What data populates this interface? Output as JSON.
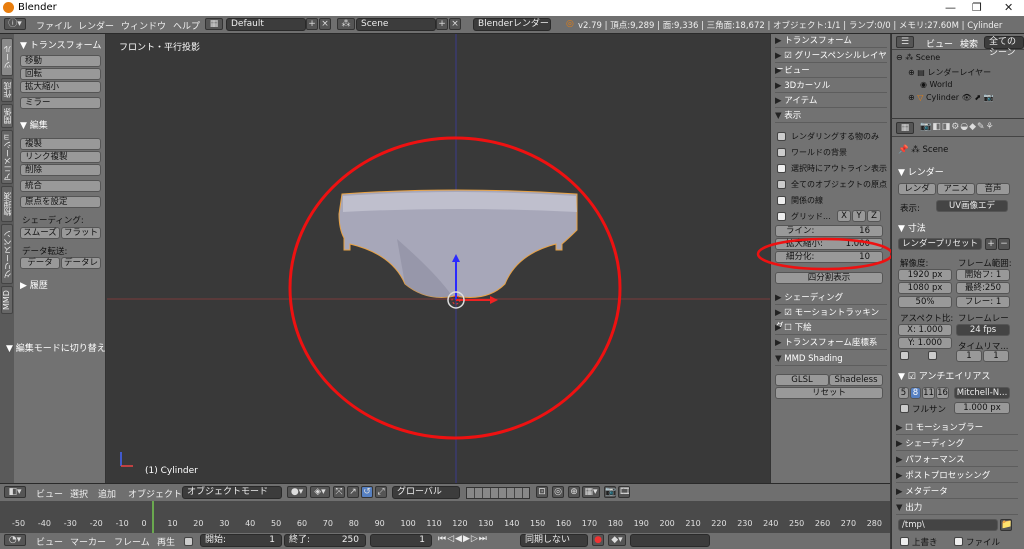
{
  "window": {
    "title": "Blender"
  },
  "info": {
    "menus": [
      "ファイル",
      "レンダー",
      "ウィンドウ",
      "ヘルプ"
    ],
    "layout": "Default",
    "scene": "Scene",
    "engine": "Blenderレンダー",
    "stats": "v2.79 | 頂点:9,289 | 面:9,336 | 三角面:18,672 | オブジェクト:1/1 | ランプ:0/0 | メモリ:27.60M | Cylinder"
  },
  "tabs": [
    "ツール",
    "作成",
    "関係",
    "アニメーション",
    "物理演算",
    "グリースペンシル",
    "MMD"
  ],
  "toolshelf": {
    "transform_header": "トランスフォーム",
    "transform": [
      "移動",
      "回転",
      "拡大縮小"
    ],
    "mirror": "ミラー",
    "edit_header": "編集",
    "edit": [
      "複製",
      "リンク複製",
      "削除"
    ],
    "join": "統合",
    "origin": "原点を設定",
    "shading_label": "シェーディング:",
    "smooth": "スムーズ",
    "flat": "フラット",
    "data_label": "データ転送:",
    "data": "データ",
    "data_l": "データレ",
    "history": "履歴",
    "op_panel": "編集モードに切り替え"
  },
  "viewport": {
    "view_name": "フロント・平行投影",
    "object_name": "(1) Cylinder"
  },
  "npanel": {
    "headers": [
      "トランスフォーム",
      "グリースペンシルレイヤー",
      "ビュー",
      "3Dカーソル",
      "アイテム",
      "表示"
    ],
    "checks": [
      "レンダリングする物のみ",
      "ワールドの背景",
      "選択時にアウトライン表示",
      "全てのオブジェクトの原点",
      "関係の線"
    ],
    "grid": "グリッド...",
    "axes": [
      "X",
      "Y",
      "Z"
    ],
    "lines_label": "ライン:",
    "lines_val": "16",
    "scale_label": "拡大縮小:",
    "scale_val": "1.000",
    "sub_label": "細分化:",
    "sub_val": "10",
    "quad": "四分割表示",
    "bottom_headers": [
      "シェーディング",
      "モーショントラッキング",
      "下絵",
      "トランスフォーム座標系"
    ],
    "mmd": "MMD Shading",
    "glsl": "GLSL",
    "shadeless": "Shadeless",
    "reset": "リセット"
  },
  "outliner": {
    "view": "ビュー",
    "search": "検索",
    "filter": "全てのシーン",
    "items": [
      "Scene",
      "レンダーレイヤー",
      "World",
      "Cylinder"
    ]
  },
  "props": {
    "scene": "Scene",
    "render": "レンダー",
    "render_btn": "レンダ",
    "anim_btn": "アニメ",
    "audio_btn": "音声",
    "display_label": "表示:",
    "display_val": "UV画像エデ",
    "dims": "寸法",
    "preset": "レンダープリセット",
    "res_label": "解像度:",
    "frame_label": "フレーム範囲:",
    "rx": "1920 px",
    "ry": "1080 px",
    "pct": "50%",
    "start": "開始フ: 1",
    "end": "最終:250",
    "step": "フレー: 1",
    "aspect_label": "アスペクト比:",
    "fr_label": "フレームレー",
    "ax": "X: 1.000",
    "ay": "Y: 1.000",
    "fps": "24 fps",
    "remap": "タイムリマ...",
    "r1": "1",
    "r2": "1",
    "aa": "アンチエイリアス",
    "aa_vals": [
      "5",
      "8",
      "11",
      "16"
    ],
    "filter": "Mitchell-N...",
    "full": "フルサン",
    "px": "1.000 px",
    "sections": [
      "モーションブラー",
      "シェーディング",
      "パフォーマンス",
      "ポストプロセッシング",
      "メタデータ",
      "出力"
    ],
    "path": "/tmp\\",
    "overwrite": "上書き",
    "file": "ファイル"
  },
  "vheader": {
    "menus": [
      "ビュー",
      "選択",
      "追加",
      "オブジェクト"
    ],
    "mode": "オブジェクトモード",
    "orient": "グローバル"
  },
  "timeline": {
    "ticks": [
      "-50",
      "-40",
      "-30",
      "-20",
      "-10",
      "0",
      "10",
      "20",
      "30",
      "40",
      "50",
      "60",
      "70",
      "80",
      "90",
      "100",
      "110",
      "120",
      "130",
      "140",
      "150",
      "160",
      "170",
      "180",
      "190",
      "200",
      "210",
      "220",
      "230",
      "240",
      "250",
      "260",
      "270",
      "280"
    ],
    "menus": [
      "ビュー",
      "マーカー",
      "フレーム",
      "再生"
    ],
    "start": "開始:",
    "start_val": "1",
    "end": "終了:",
    "end_val": "250",
    "cur": "1",
    "sync": "同期しない"
  },
  "colors": {
    "accent": "#e87d0d",
    "highlight": "#ee1111",
    "selected": "#5680c2"
  }
}
